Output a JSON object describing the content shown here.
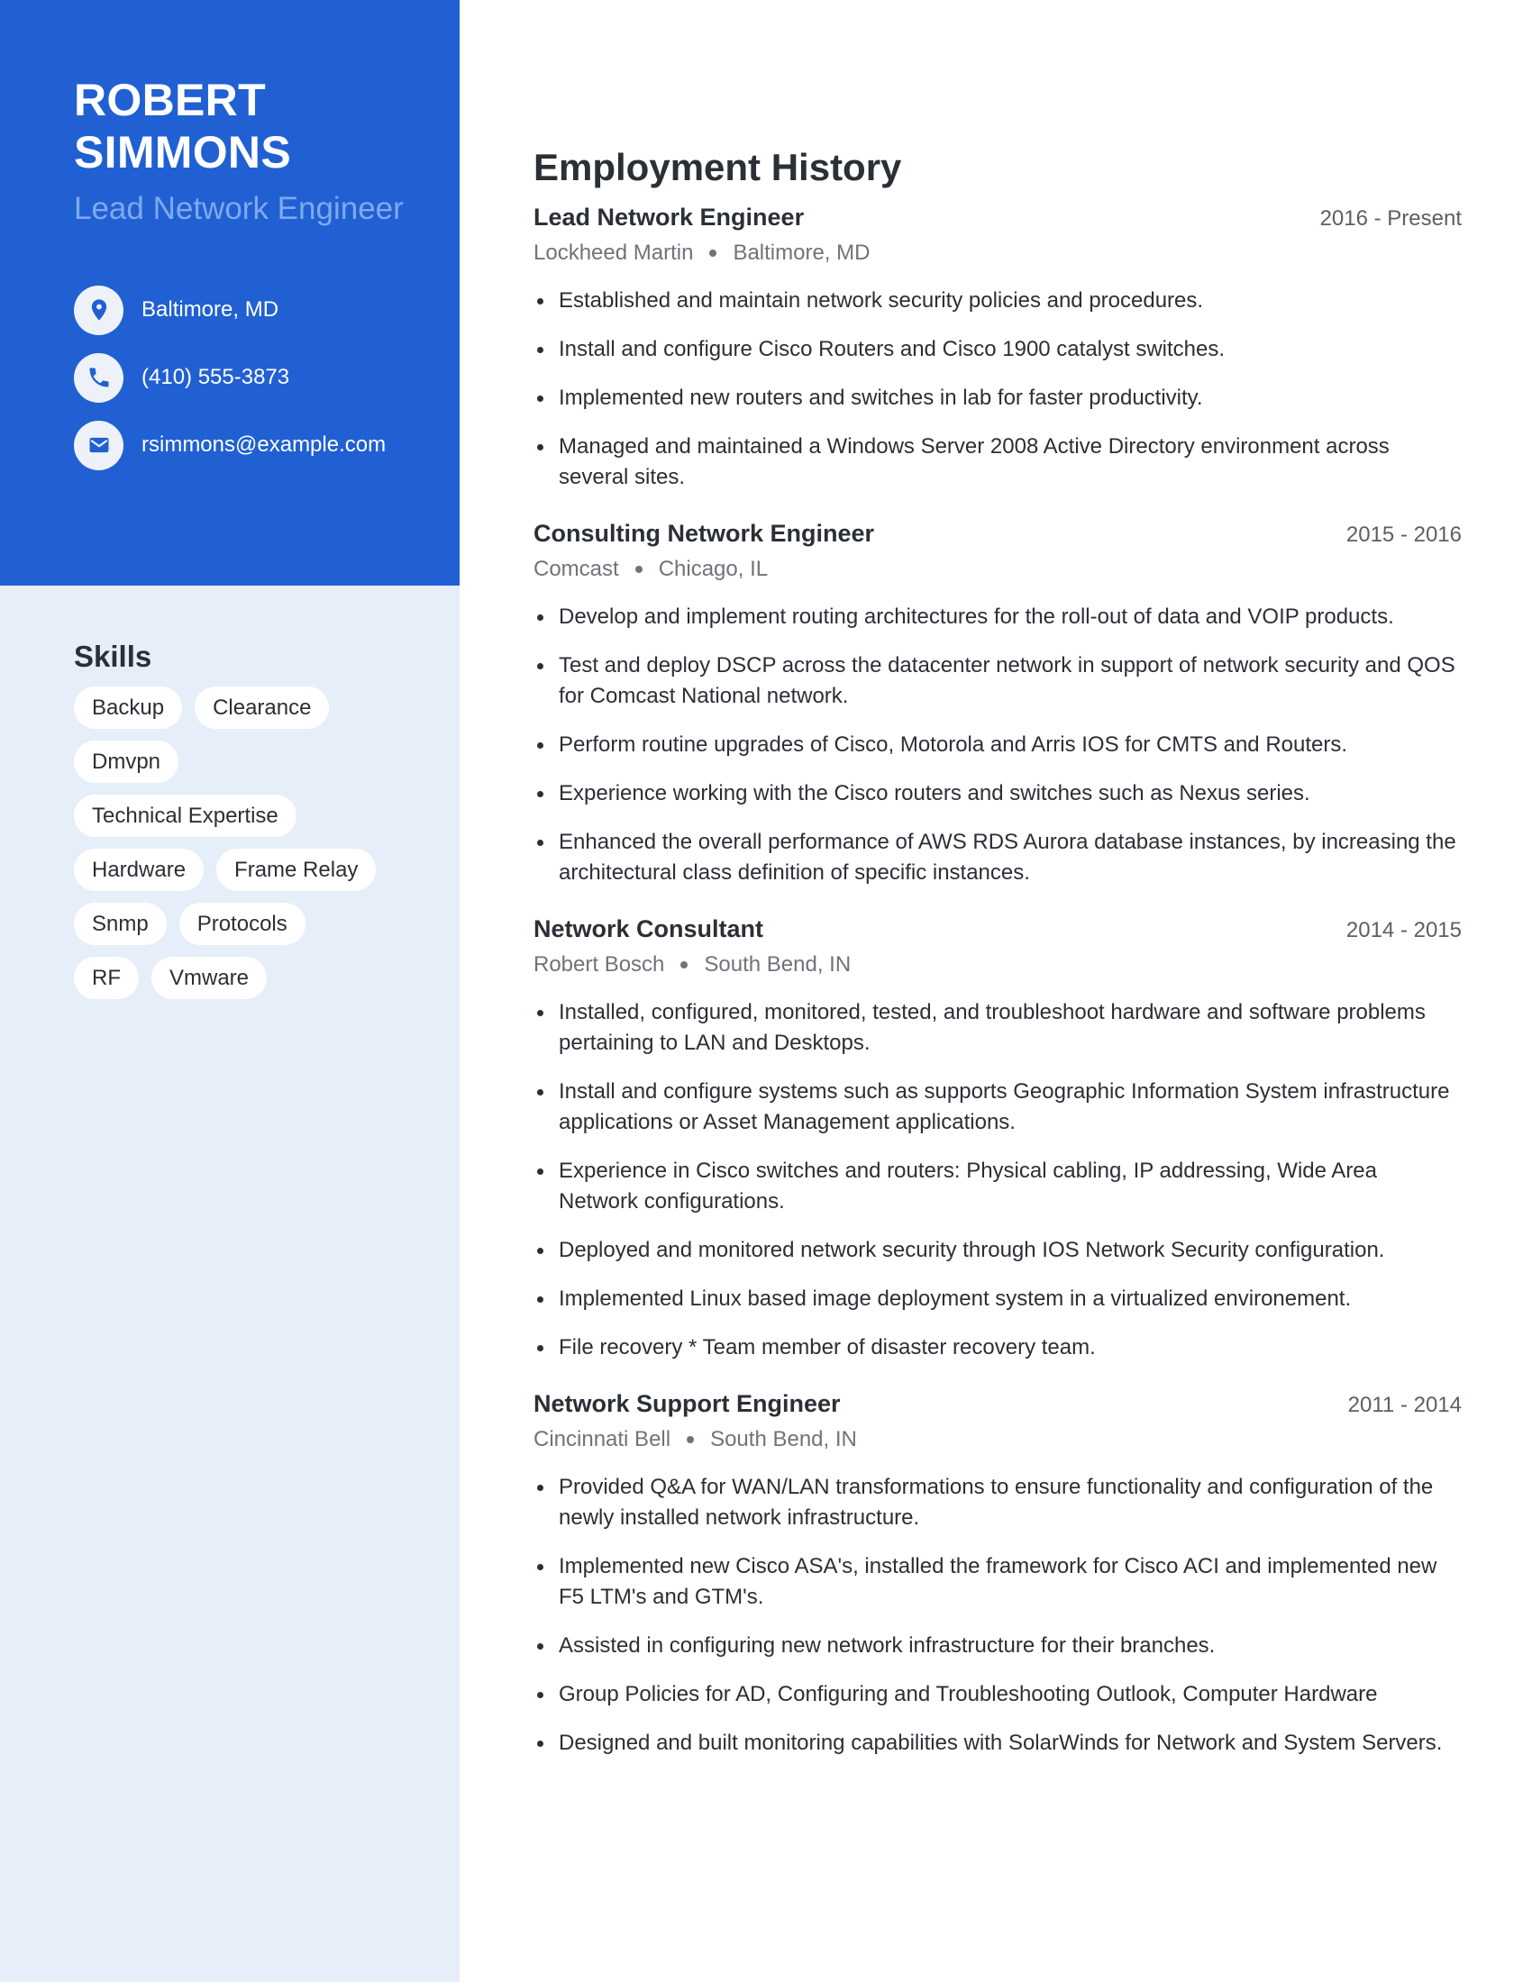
{
  "header": {
    "first_name": "ROBERT",
    "last_name": "SIMMONS",
    "title": "Lead Network Engineer"
  },
  "contacts": [
    {
      "icon": "map-pin-icon",
      "text": "Baltimore, MD"
    },
    {
      "icon": "phone-icon",
      "text": "(410) 555-3873"
    },
    {
      "icon": "envelope-icon",
      "text": "rsimmons@example.com"
    }
  ],
  "skills": {
    "title": "Skills",
    "items": [
      "Backup",
      "Clearance",
      "Dmvpn",
      "Technical Expertise",
      "Hardware",
      "Frame Relay",
      "Snmp",
      "Protocols",
      "RF",
      "Vmware"
    ]
  },
  "employment": {
    "title": "Employment History",
    "jobs": [
      {
        "role": "Lead Network Engineer",
        "dates": "2016 - Present",
        "company": "Lockheed Martin",
        "location": "Baltimore, MD",
        "bullets": [
          "Established and maintain network security policies and procedures.",
          "Install and configure Cisco Routers and Cisco 1900 catalyst switches.",
          "Implemented new routers and switches in lab for faster productivity.",
          "Managed and maintained a Windows Server 2008 Active Directory environment across several sites."
        ]
      },
      {
        "role": "Consulting Network Engineer",
        "dates": "2015 - 2016",
        "company": "Comcast",
        "location": "Chicago, IL",
        "bullets": [
          "Develop and implement routing architectures for the roll-out of data and VOIP products.",
          "Test and deploy DSCP across the datacenter network in support of network security and QOS for Comcast National network.",
          "Perform routine upgrades of Cisco, Motorola and Arris IOS for CMTS and Routers.",
          "Experience working with the Cisco routers and switches such as Nexus series.",
          "Enhanced the overall performance of AWS RDS Aurora database instances, by increasing the architectural class definition of specific instances."
        ]
      },
      {
        "role": "Network Consultant",
        "dates": "2014 - 2015",
        "company": "Robert Bosch",
        "location": "South Bend, IN",
        "bullets": [
          "Installed, configured, monitored, tested, and troubleshoot hardware and software problems pertaining to LAN and Desktops.",
          "Install and configure systems such as supports Geographic Information System infrastructure applications or Asset Management applications.",
          "Experience in Cisco switches and routers: Physical cabling, IP addressing, Wide Area Network configurations.",
          "Deployed and monitored network security through IOS Network Security configuration.",
          "Implemented Linux based image deployment system in a virtualized environement.",
          "File recovery * Team member of disaster recovery team."
        ]
      },
      {
        "role": "Network Support Engineer",
        "dates": "2011 - 2014",
        "company": "Cincinnati Bell",
        "location": "South Bend, IN",
        "bullets": [
          "Provided Q&A for WAN/LAN transformations to ensure functionality and configuration of the newly installed network infrastructure.",
          "Implemented new Cisco ASA's, installed the framework for Cisco ACI and implemented new F5 LTM's and GTM's.",
          "Assisted in configuring new network infrastructure for their branches.",
          "Group Policies for AD, Configuring and Troubleshooting Outlook, Computer Hardware",
          "Designed and built monitoring capabilities with SolarWinds for Network and System Servers."
        ]
      }
    ]
  },
  "colors": {
    "accent": "#2160d3",
    "sidebar_bg": "#e6eef9",
    "title_light": "#7fa9ee"
  }
}
